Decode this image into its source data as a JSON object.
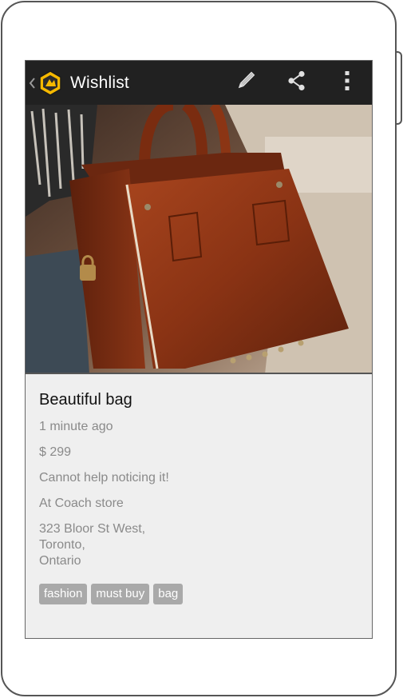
{
  "actionbar": {
    "title": "Wishlist",
    "actions": [
      "edit",
      "share",
      "more"
    ]
  },
  "item": {
    "title": "Beautiful bag",
    "time": "1 minute ago",
    "price": "$ 299",
    "note": "Cannot help noticing it!",
    "store": "At Coach store",
    "address_lines": [
      "323 Bloor St West,",
      "Toronto,",
      "Ontario"
    ],
    "tags": [
      "fashion",
      "must buy",
      "bag"
    ]
  },
  "colors": {
    "actionbar_bg": "#212121",
    "logo_yellow": "#f5b800",
    "tag_bg": "#a9a9a9",
    "secondary_text": "#8a8a8a"
  }
}
